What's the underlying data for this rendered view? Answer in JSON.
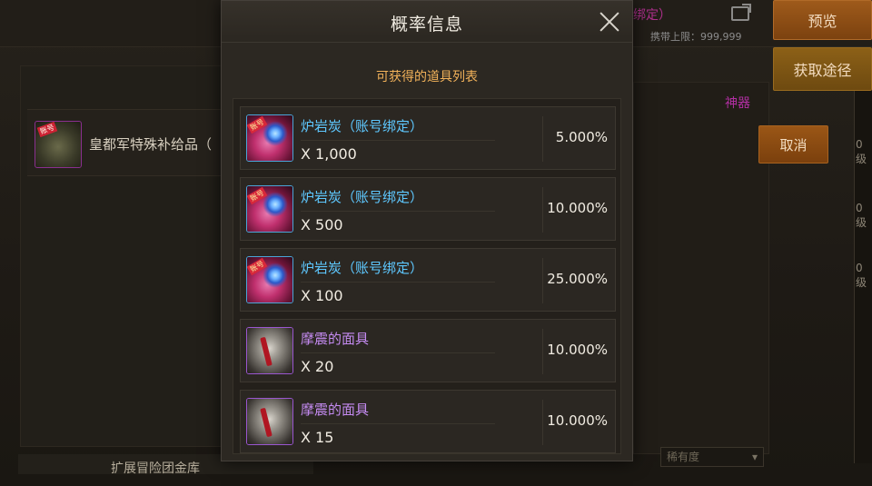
{
  "modal": {
    "title": "概率信息",
    "subtitle": "可获得的道具列表",
    "items": [
      {
        "name": "炉岩炭（账号绑定）",
        "quantity": "X 1,000",
        "rate": "5.000%",
        "icon": "lava-charcoal-icon",
        "badge": "账号"
      },
      {
        "name": "炉岩炭（账号绑定）",
        "quantity": "X 500",
        "rate": "10.000%",
        "icon": "lava-charcoal-icon",
        "badge": "账号"
      },
      {
        "name": "炉岩炭（账号绑定）",
        "quantity": "X 100",
        "rate": "25.000%",
        "icon": "lava-charcoal-icon",
        "badge": "账号"
      },
      {
        "name": "摩震的面具",
        "quantity": "X 20",
        "rate": "10.000%",
        "icon": "mask-icon"
      },
      {
        "name": "摩震的面具",
        "quantity": "X 15",
        "rate": "10.000%",
        "icon": "mask-icon"
      }
    ]
  },
  "background": {
    "item_name": "皇都军特殊补给品（",
    "item_badge": "账号",
    "top_pink_text": "绑定）",
    "carry_label": "携带上限：",
    "carry_value": "999,999",
    "artifact_label": "神器",
    "preview_button": "预览",
    "source_button": "获取途径",
    "cancel_button": "取消",
    "bottom_label": "扩展冒险团金库",
    "dropdown_value": "稀有度",
    "level_suffix": "0级"
  },
  "colors": {
    "rate_blue_name": "#5ec8ff",
    "rate_purple_name": "#c58bf2",
    "subtitle": "#f2b25a",
    "accent_orange": "#9e5a1b"
  }
}
